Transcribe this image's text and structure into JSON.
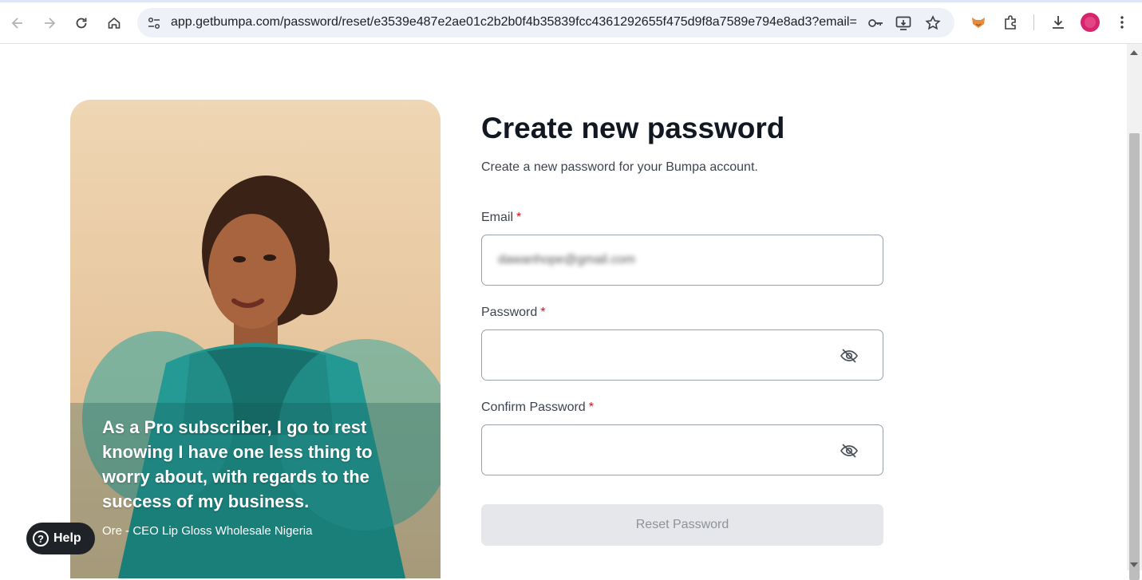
{
  "browser": {
    "url": "app.getbumpa.com/password/reset/e3539e487e2ae01c2b2b0f4b35839fcc4361292655f475d9f8a7589e794e8ad3?email=d...",
    "icons": [
      "back-icon",
      "forward-icon",
      "reload-icon",
      "home-icon",
      "site-info-icon",
      "password-key-icon",
      "install-app-icon",
      "bookmark-star-icon",
      "extension-fox-icon",
      "extensions-puzzle-icon",
      "download-icon",
      "profile-avatar",
      "menu-kebab-icon"
    ]
  },
  "hero": {
    "quote": "As a Pro subscriber, I go to rest knowing I have one less thing to worry about, with regards to the success of my business.",
    "author": "Ore - CEO Lip Gloss Wholesale Nigeria"
  },
  "help": {
    "label": "Help"
  },
  "form": {
    "title": "Create new password",
    "subtitle": "Create a new password for your Bumpa account.",
    "email_label": "Email",
    "email_value": "dawanhope@gmail.com",
    "password_label": "Password",
    "confirm_label": "Confirm Password",
    "required_mark": "*",
    "submit_label": "Reset Password"
  },
  "colors": {
    "accent_required": "#d0161b",
    "button_disabled_bg": "#e6e7ea",
    "dress_teal": "#1f8f8a"
  }
}
